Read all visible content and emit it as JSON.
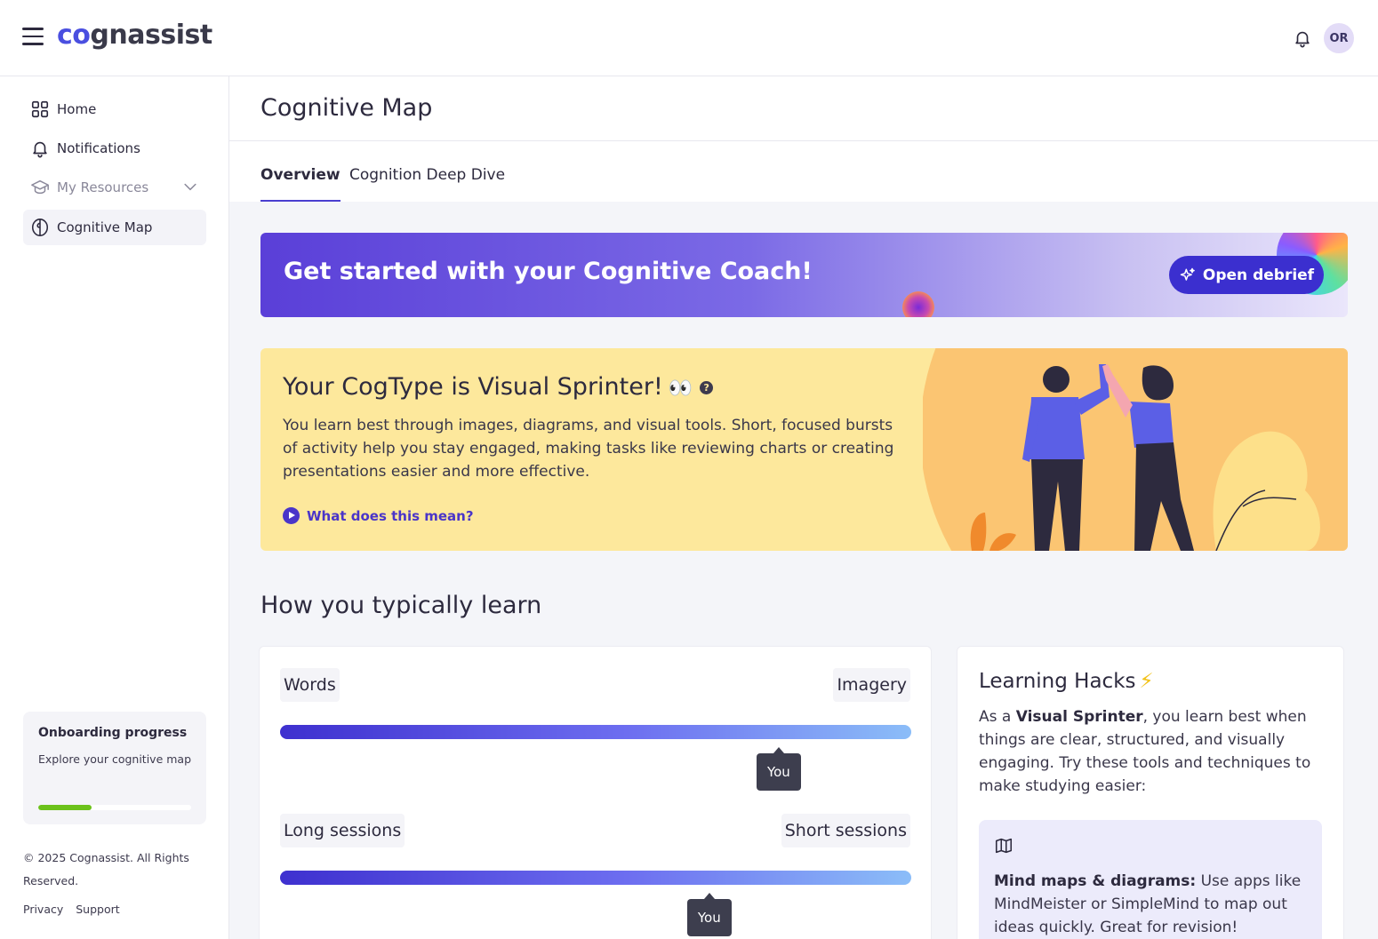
{
  "app": {
    "logo_prefix": "co",
    "logo_suffix": "gnassist",
    "avatar_initials": "OR"
  },
  "sidebar": {
    "items": [
      {
        "label": "Home",
        "icon": "grid-icon"
      },
      {
        "label": "Notifications",
        "icon": "bell-icon"
      },
      {
        "label": "My Resources",
        "icon": "graduation-cap-icon"
      },
      {
        "label": "Cognitive Map",
        "icon": "brain-icon"
      }
    ],
    "onboarding": {
      "title": "Onboarding progress",
      "description": "Explore your cognitive map",
      "progress": 0.35
    },
    "copyright": "© 2025 Cognassist. All Rights Reserved.",
    "links": [
      "Privacy",
      "Support"
    ]
  },
  "page": {
    "title": "Cognitive Map",
    "tabs": [
      "Overview",
      "Cognition Deep Dive"
    ],
    "active_tab": "Overview"
  },
  "banner": {
    "title": "Get started with your Cognitive Coach!",
    "button_label": "Open debrief"
  },
  "cogtype": {
    "title": "Your CogType is Visual Sprinter!",
    "emoji": "👀",
    "description": "You learn best through images, diagrams, and visual tools. Short, focused bursts of activity help you stay engaged, making tasks like reviewing charts or creating presentations easier and more effective.",
    "link_label": "What does this mean?"
  },
  "learning": {
    "section_title": "How you typically learn",
    "scales": [
      {
        "left": "Words",
        "right": "Imagery",
        "marker": "You",
        "position": 0.79
      },
      {
        "left": "Long sessions",
        "right": "Short sessions",
        "marker": "You",
        "position": 0.68
      }
    ]
  },
  "hacks": {
    "title": "Learning Hacks",
    "intro_prefix": "As a ",
    "intro_bold": "Visual Sprinter",
    "intro_suffix": ", you learn best when things are clear, structured, and visually engaging. Try these tools and techniques to make studying easier:",
    "tip_bold": "Mind maps & diagrams:",
    "tip_text": " Use apps like MindMeister or SimpleMind to map out ideas quickly. Great for revision!",
    "tip_icon": "map-icon"
  },
  "colors": {
    "accent": "#3b2fcf",
    "progress": "#6cc21b",
    "cogtype_bg": "#fde89c"
  }
}
